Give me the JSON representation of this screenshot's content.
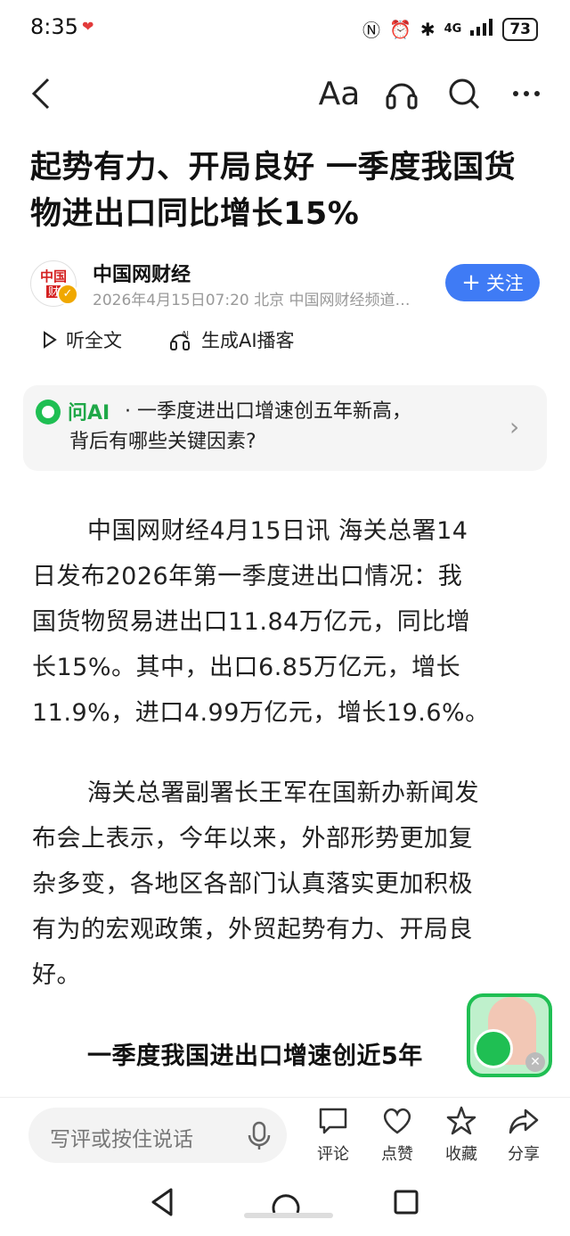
{
  "status_bar": {
    "time": "8:35",
    "battery": "73",
    "network": "4G"
  },
  "nav": {
    "font_size_label": "Aa",
    "back_icon": "back-arrow-icon",
    "listen_icon": "headphones-icon",
    "search_icon": "search-icon",
    "more_icon": "more-icon"
  },
  "article": {
    "title_line1": "起势有力、开局良好 一季度我国货",
    "title_line2": "物进出口同比增长15%",
    "author": "中国网财经",
    "meta": "2026年4月15日07:20 北京 中国网财经频道…",
    "logo_top": "中国",
    "logo_bottom": "财",
    "follow_label": "关注",
    "listen_label": "听全文",
    "podcast_label": "生成AI播客",
    "ai": {
      "label": "问AI",
      "question_line1": "· 一季度进出口增速创五年新高，",
      "question_line2": "背后有哪些关键因素?"
    },
    "paragraphs": [
      [
        "中国网财经4月15日讯 海关总署14",
        "日发布2026年第一季度进出口情况：我",
        "国货物贸易进出口11.84万亿元，同比增",
        "长15%。其中，出口6.85万亿元，增长",
        "11.9%，进口4.99万亿元，增长19.6%。"
      ],
      [
        "海关总署副署长王军在国新办新闻发",
        "布会上表示，今年以来，外部形势更加复",
        "杂多变，各地区各部门认真落实更加积极",
        "有为的宏观政策，外贸起势有力、开局良",
        "好。"
      ]
    ],
    "subheading": "一季度我国进出口增速创近5年"
  },
  "bottom_bar": {
    "comment_placeholder": "写评或按住说话",
    "actions": [
      {
        "label": "评论",
        "icon": "comment-icon"
      },
      {
        "label": "点赞",
        "icon": "heart-icon"
      },
      {
        "label": "收藏",
        "icon": "star-icon"
      },
      {
        "label": "分享",
        "icon": "share-icon"
      }
    ]
  },
  "colors": {
    "accent_blue": "#3f7bf5",
    "ai_green": "#1fbf53"
  }
}
